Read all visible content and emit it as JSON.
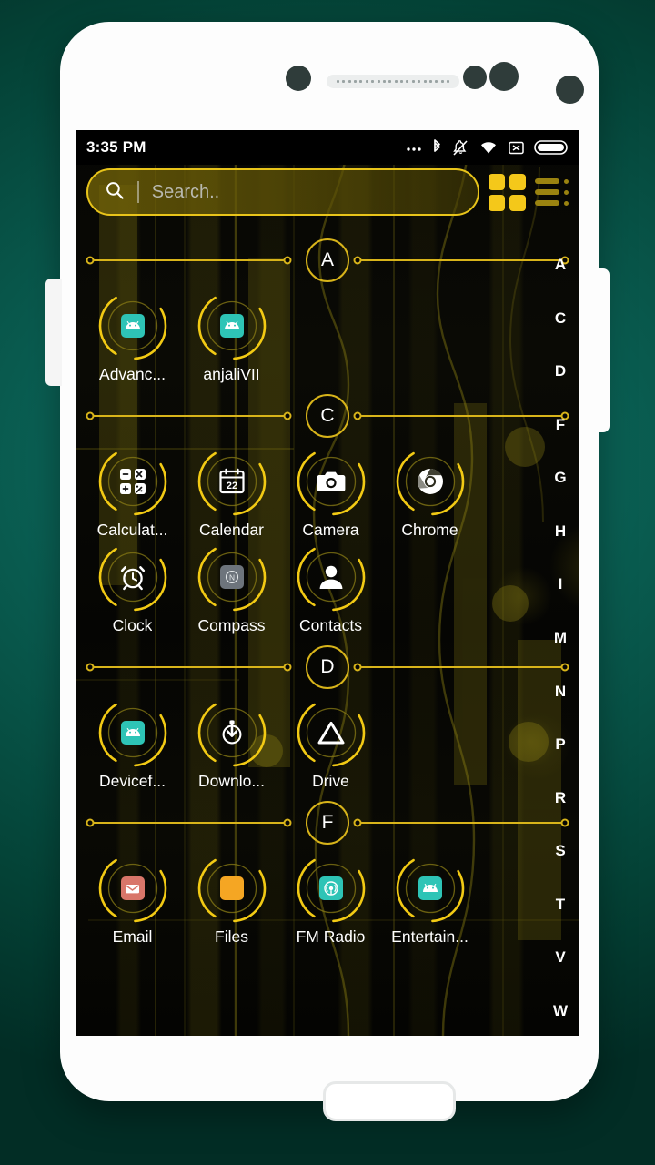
{
  "device": {
    "frame_color": "#fdfdfd",
    "wallpaper_accent": "#e8c41a",
    "background_color": "#0a5f53"
  },
  "status_bar": {
    "time": "3:35 PM",
    "icons": [
      "more-dots-icon",
      "bluetooth-icon",
      "notification-muted-icon",
      "wifi-icon",
      "no-sim-icon",
      "battery-icon"
    ]
  },
  "search": {
    "placeholder": "Search..",
    "value": "",
    "icon": "search-icon"
  },
  "view_toggle": {
    "grid_label": "grid-view",
    "list_label": "list-view",
    "active": "grid"
  },
  "alpha_index": [
    "A",
    "C",
    "D",
    "F",
    "G",
    "H",
    "I",
    "M",
    "N",
    "P",
    "R",
    "S",
    "T",
    "V",
    "W"
  ],
  "sections": [
    {
      "letter": "A",
      "apps": [
        {
          "label": "Advanc...",
          "icon": "android-app-icon",
          "icon_color": "#2ec4b6"
        },
        {
          "label": "anjaliVII",
          "icon": "android-app-icon",
          "icon_color": "#2ec4b6"
        }
      ]
    },
    {
      "letter": "C",
      "apps": [
        {
          "label": "Calculat...",
          "icon": "calculator-icon",
          "icon_color": "#ffffff"
        },
        {
          "label": "Calendar",
          "icon": "calendar-icon",
          "icon_color": "#ffffff",
          "day": "22"
        },
        {
          "label": "Camera",
          "icon": "camera-icon",
          "icon_color": "#ffffff"
        },
        {
          "label": "Chrome",
          "icon": "chrome-icon",
          "icon_color": "#ffffff"
        },
        {
          "label": "Clock",
          "icon": "alarm-clock-icon",
          "icon_color": "#ffffff"
        },
        {
          "label": "Compass",
          "icon": "compass-icon",
          "icon_color": "#8c9298"
        },
        {
          "label": "Contacts",
          "icon": "contacts-person-icon",
          "icon_color": "#ffffff"
        }
      ]
    },
    {
      "letter": "D",
      "apps": [
        {
          "label": "Devicef...",
          "icon": "android-app-icon",
          "icon_color": "#2ec4b6"
        },
        {
          "label": "Downlo...",
          "icon": "download-icon",
          "icon_color": "#ffffff"
        },
        {
          "label": "Drive",
          "icon": "drive-triangle-icon",
          "icon_color": "#ffffff"
        }
      ]
    },
    {
      "letter": "F",
      "apps": [
        {
          "label": "Email",
          "icon": "email-icon",
          "icon_color": "#d9766a"
        },
        {
          "label": "Files",
          "icon": "folder-icon",
          "icon_color": "#f5a623"
        },
        {
          "label": "FM Radio",
          "icon": "fm-radio-icon",
          "icon_color": "#2ec4b6"
        },
        {
          "label": "Entertain...",
          "icon": "android-app-icon",
          "icon_color": "#2ec4b6"
        }
      ]
    }
  ]
}
